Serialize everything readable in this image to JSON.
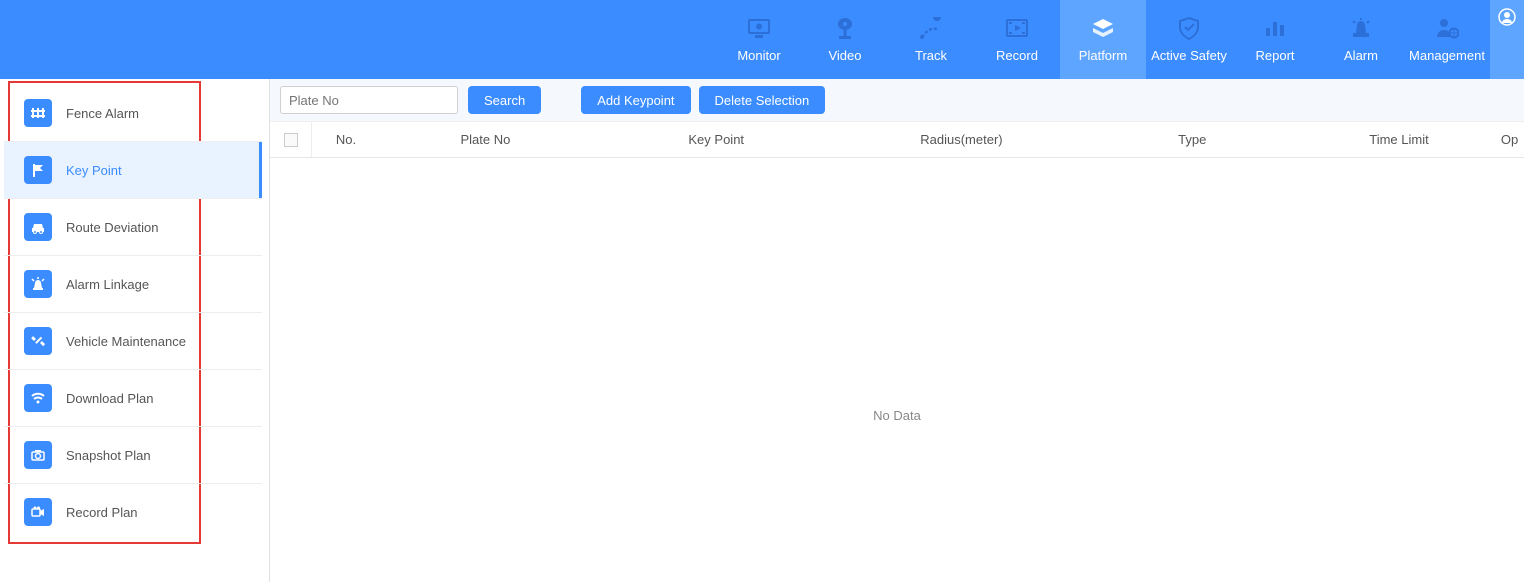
{
  "header": {
    "tabs": [
      {
        "id": "monitor",
        "label": "Monitor",
        "active": false
      },
      {
        "id": "video",
        "label": "Video",
        "active": false
      },
      {
        "id": "track",
        "label": "Track",
        "active": false
      },
      {
        "id": "record",
        "label": "Record",
        "active": false
      },
      {
        "id": "platform",
        "label": "Platform",
        "active": true
      },
      {
        "id": "active-safety",
        "label": "Active Safety",
        "active": false
      },
      {
        "id": "report",
        "label": "Report",
        "active": false
      },
      {
        "id": "alarm",
        "label": "Alarm",
        "active": false
      },
      {
        "id": "management",
        "label": "Management",
        "active": false
      }
    ]
  },
  "sidebar": {
    "items": [
      {
        "id": "fence-alarm",
        "label": "Fence Alarm",
        "active": false
      },
      {
        "id": "key-point",
        "label": "Key Point",
        "active": true
      },
      {
        "id": "route-deviation",
        "label": "Route Deviation",
        "active": false
      },
      {
        "id": "alarm-linkage",
        "label": "Alarm Linkage",
        "active": false
      },
      {
        "id": "vehicle-maintenance",
        "label": "Vehicle Maintenance",
        "active": false
      },
      {
        "id": "download-plan",
        "label": "Download Plan",
        "active": false
      },
      {
        "id": "snapshot-plan",
        "label": "Snapshot Plan",
        "active": false
      },
      {
        "id": "record-plan",
        "label": "Record Plan",
        "active": false
      }
    ]
  },
  "toolbar": {
    "plate_placeholder": "Plate No",
    "plate_value": "",
    "search_label": "Search",
    "add_keypoint_label": "Add Keypoint",
    "delete_selection_label": "Delete Selection"
  },
  "table": {
    "columns": {
      "no": "No.",
      "plate": "Plate No",
      "keypoint": "Key Point",
      "radius": "Radius(meter)",
      "type": "Type",
      "timelimit": "Time Limit",
      "op": "Op"
    },
    "no_data": "No Data",
    "rows": []
  }
}
